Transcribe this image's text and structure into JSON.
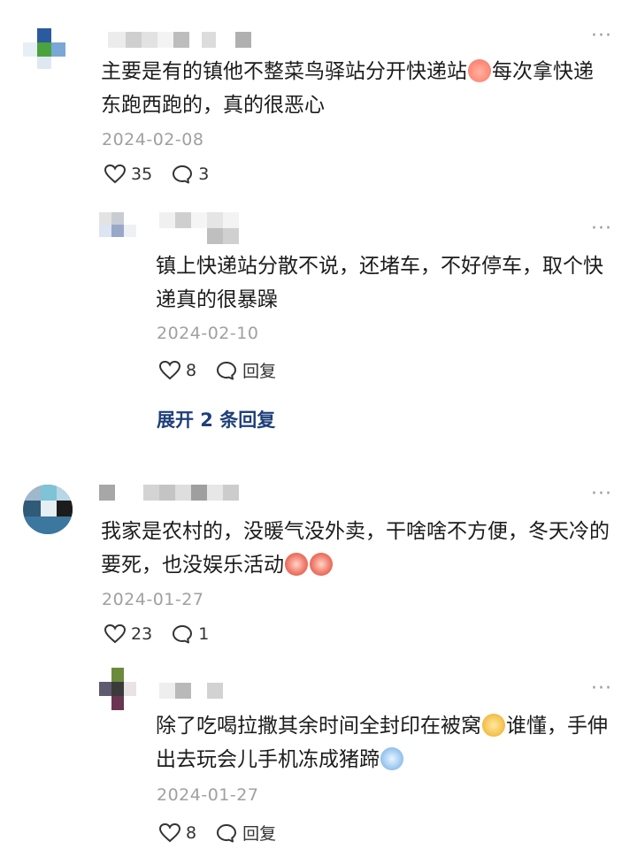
{
  "comments": [
    {
      "text_before": "主要是有的镇他不整菜鸟驿站分开快递站",
      "emoji1": "peach-face-emoji",
      "text_after": "每次拿快递东跑西跑的，真的很恶心",
      "date": "2024-02-08",
      "likes": "35",
      "replies": "3",
      "reply": {
        "text": "镇上快递站分散不说，还堵车，不好停车，取个快递真的很暴躁",
        "date": "2024-02-10",
        "likes": "8",
        "reply_label": "回复"
      },
      "expand_label": "展开 2 条回复"
    },
    {
      "text": "我家是农村的，没暖气没外卖，干啥啥不方便，冬天冷的要死，也没娱乐活动",
      "emoji": "crying-face-emoji",
      "date": "2024-01-27",
      "likes": "23",
      "replies": "1",
      "reply": {
        "text_before": "除了吃喝拉撒其余时间全封印在被窝",
        "emoji1": "smug-face-emoji",
        "text_mid": "谁懂，手伸出去玩会儿手机冻成猪蹄",
        "emoji2": "frozen-face-emoji",
        "date": "2024-01-27",
        "likes": "8",
        "reply_label": "回复"
      }
    }
  ],
  "more_label": "···"
}
